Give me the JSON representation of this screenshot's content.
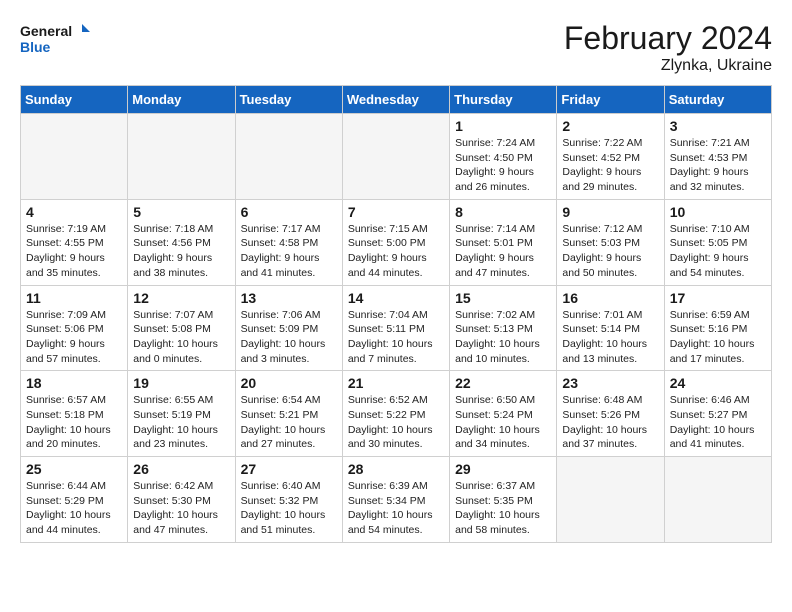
{
  "header": {
    "logo_line1": "General",
    "logo_line2": "Blue",
    "month": "February 2024",
    "location": "Zlynka, Ukraine"
  },
  "weekdays": [
    "Sunday",
    "Monday",
    "Tuesday",
    "Wednesday",
    "Thursday",
    "Friday",
    "Saturday"
  ],
  "weeks": [
    [
      {
        "day": "",
        "info": ""
      },
      {
        "day": "",
        "info": ""
      },
      {
        "day": "",
        "info": ""
      },
      {
        "day": "",
        "info": ""
      },
      {
        "day": "1",
        "info": "Sunrise: 7:24 AM\nSunset: 4:50 PM\nDaylight: 9 hours\nand 26 minutes."
      },
      {
        "day": "2",
        "info": "Sunrise: 7:22 AM\nSunset: 4:52 PM\nDaylight: 9 hours\nand 29 minutes."
      },
      {
        "day": "3",
        "info": "Sunrise: 7:21 AM\nSunset: 4:53 PM\nDaylight: 9 hours\nand 32 minutes."
      }
    ],
    [
      {
        "day": "4",
        "info": "Sunrise: 7:19 AM\nSunset: 4:55 PM\nDaylight: 9 hours\nand 35 minutes."
      },
      {
        "day": "5",
        "info": "Sunrise: 7:18 AM\nSunset: 4:56 PM\nDaylight: 9 hours\nand 38 minutes."
      },
      {
        "day": "6",
        "info": "Sunrise: 7:17 AM\nSunset: 4:58 PM\nDaylight: 9 hours\nand 41 minutes."
      },
      {
        "day": "7",
        "info": "Sunrise: 7:15 AM\nSunset: 5:00 PM\nDaylight: 9 hours\nand 44 minutes."
      },
      {
        "day": "8",
        "info": "Sunrise: 7:14 AM\nSunset: 5:01 PM\nDaylight: 9 hours\nand 47 minutes."
      },
      {
        "day": "9",
        "info": "Sunrise: 7:12 AM\nSunset: 5:03 PM\nDaylight: 9 hours\nand 50 minutes."
      },
      {
        "day": "10",
        "info": "Sunrise: 7:10 AM\nSunset: 5:05 PM\nDaylight: 9 hours\nand 54 minutes."
      }
    ],
    [
      {
        "day": "11",
        "info": "Sunrise: 7:09 AM\nSunset: 5:06 PM\nDaylight: 9 hours\nand 57 minutes."
      },
      {
        "day": "12",
        "info": "Sunrise: 7:07 AM\nSunset: 5:08 PM\nDaylight: 10 hours\nand 0 minutes."
      },
      {
        "day": "13",
        "info": "Sunrise: 7:06 AM\nSunset: 5:09 PM\nDaylight: 10 hours\nand 3 minutes."
      },
      {
        "day": "14",
        "info": "Sunrise: 7:04 AM\nSunset: 5:11 PM\nDaylight: 10 hours\nand 7 minutes."
      },
      {
        "day": "15",
        "info": "Sunrise: 7:02 AM\nSunset: 5:13 PM\nDaylight: 10 hours\nand 10 minutes."
      },
      {
        "day": "16",
        "info": "Sunrise: 7:01 AM\nSunset: 5:14 PM\nDaylight: 10 hours\nand 13 minutes."
      },
      {
        "day": "17",
        "info": "Sunrise: 6:59 AM\nSunset: 5:16 PM\nDaylight: 10 hours\nand 17 minutes."
      }
    ],
    [
      {
        "day": "18",
        "info": "Sunrise: 6:57 AM\nSunset: 5:18 PM\nDaylight: 10 hours\nand 20 minutes."
      },
      {
        "day": "19",
        "info": "Sunrise: 6:55 AM\nSunset: 5:19 PM\nDaylight: 10 hours\nand 23 minutes."
      },
      {
        "day": "20",
        "info": "Sunrise: 6:54 AM\nSunset: 5:21 PM\nDaylight: 10 hours\nand 27 minutes."
      },
      {
        "day": "21",
        "info": "Sunrise: 6:52 AM\nSunset: 5:22 PM\nDaylight: 10 hours\nand 30 minutes."
      },
      {
        "day": "22",
        "info": "Sunrise: 6:50 AM\nSunset: 5:24 PM\nDaylight: 10 hours\nand 34 minutes."
      },
      {
        "day": "23",
        "info": "Sunrise: 6:48 AM\nSunset: 5:26 PM\nDaylight: 10 hours\nand 37 minutes."
      },
      {
        "day": "24",
        "info": "Sunrise: 6:46 AM\nSunset: 5:27 PM\nDaylight: 10 hours\nand 41 minutes."
      }
    ],
    [
      {
        "day": "25",
        "info": "Sunrise: 6:44 AM\nSunset: 5:29 PM\nDaylight: 10 hours\nand 44 minutes."
      },
      {
        "day": "26",
        "info": "Sunrise: 6:42 AM\nSunset: 5:30 PM\nDaylight: 10 hours\nand 47 minutes."
      },
      {
        "day": "27",
        "info": "Sunrise: 6:40 AM\nSunset: 5:32 PM\nDaylight: 10 hours\nand 51 minutes."
      },
      {
        "day": "28",
        "info": "Sunrise: 6:39 AM\nSunset: 5:34 PM\nDaylight: 10 hours\nand 54 minutes."
      },
      {
        "day": "29",
        "info": "Sunrise: 6:37 AM\nSunset: 5:35 PM\nDaylight: 10 hours\nand 58 minutes."
      },
      {
        "day": "",
        "info": ""
      },
      {
        "day": "",
        "info": ""
      }
    ]
  ]
}
